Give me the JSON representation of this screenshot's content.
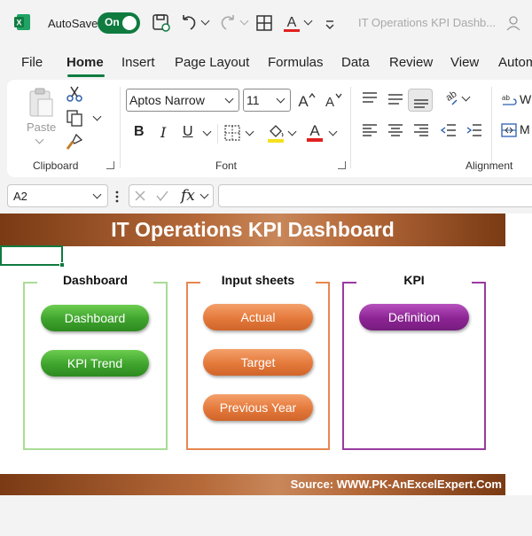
{
  "titlebar": {
    "autosave_label": "AutoSave",
    "toggle_label": "On",
    "doc_title": "IT Operations KPI Dashb..."
  },
  "tabs": [
    "File",
    "Home",
    "Insert",
    "Page Layout",
    "Formulas",
    "Data",
    "Review",
    "View",
    "Autom"
  ],
  "ribbon": {
    "clipboard": {
      "paste_label": "Paste",
      "group_label": "Clipboard"
    },
    "font": {
      "font_name": "Aptos Narrow",
      "font_size": "11",
      "group_label": "Font",
      "bold": "B",
      "italic": "I",
      "underline": "U"
    },
    "alignment": {
      "group_label": "Alignment",
      "wrap_letter": "W",
      "merge_letter": "M"
    }
  },
  "formula_bar": {
    "name_box": "A2",
    "fx": "fx",
    "formula": ""
  },
  "sheet": {
    "banner_title": "IT Operations KPI Dashboard",
    "footer": "Source: WWW.PK-AnExcelExpert.Com",
    "panels": [
      {
        "title": "Dashboard",
        "color": "#8fd07c",
        "buttons": [
          "Dashboard",
          "KPI Trend"
        ]
      },
      {
        "title": "Input sheets",
        "color": "#e8874f",
        "buttons": [
          "Actual",
          "Target",
          "Previous Year"
        ]
      },
      {
        "title": "KPI",
        "color": "#9a3aa0",
        "buttons": [
          "Definition"
        ]
      }
    ]
  }
}
